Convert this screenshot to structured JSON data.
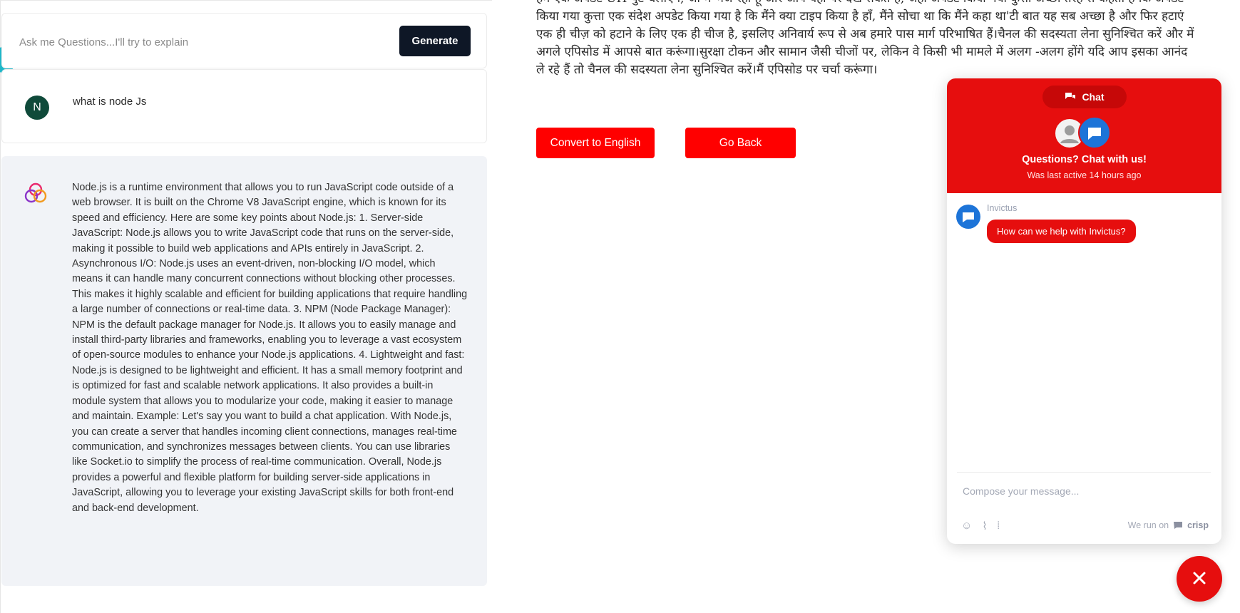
{
  "ask": {
    "placeholder": "Ask me Questions...I'll try to explain",
    "generate_label": "Generate"
  },
  "question": {
    "avatar_initial": "N",
    "text": "what is node Js"
  },
  "answer": {
    "text": "Node.js is a runtime environment that allows you to run JavaScript code outside of a web browser. It is built on the Chrome V8 JavaScript engine, which is known for its speed and efficiency. Here are some key points about Node.js: 1. Server-side JavaScript: Node.js allows you to write JavaScript code that runs on the server-side, making it possible to build web applications and APIs entirely in JavaScript. 2. Asynchronous I/O: Node.js uses an event-driven, non-blocking I/O model, which means it can handle many concurrent connections without blocking other processes. This makes it highly scalable and efficient for building applications that require handling a large number of connections or real-time data. 3. NPM (Node Package Manager): NPM is the default package manager for Node.js. It allows you to easily manage and install third-party libraries and frameworks, enabling you to leverage a vast ecosystem of open-source modules to enhance your Node.js applications. 4. Lightweight and fast: Node.js is designed to be lightweight and efficient. It has a small memory footprint and is optimized for fast and scalable network applications. It also provides a built-in module system that allows you to modularize your code, making it easier to manage and maintain. Example: Let's say you want to build a chat application. With Node.js, you can create a server that handles incoming client connections, manages real-time communication, and synchronizes messages between clients. You can use libraries like Socket.io to simplify the process of real-time communication. Overall, Node.js provides a powerful and flexible platform for building server-side applications in JavaScript, allowing you to leverage your existing JavaScript skills for both front-end and back-end development."
  },
  "translation": {
    "hindi_text": "हम एक अपडेट UH पुट चलाएंगे, जो मैं भेज रहा हूँ और आप यहाँ पर देख सकते हैं, जहाँ अपडेट किया गया कुत्ता अच्छी तरह से कहता है कि अपडेट किया गया कुत्ता एक संदेश अपडेट किया गया है कि मैंने क्या टाइप किया है हाँ, मैंने सोचा था कि मैंने कहा था'टी बात यह सब अच्छा है और फिर हटाएं एक ही चीज़ को हटाने के लिए एक ही चीज है, इसलिए अनिवार्य रूप से अब हमारे पास मार्ग परिभाषित हैं।चैनल की सदस्यता लेना सुनिश्चित करें और में अगले एपिसोड में आपसे बात करूंगा।सुरक्षा टोकन और सामान जैसी चीजों पर, लेकिन वे किसी भी मामले में अलग -अलग होंगे यदि आप इसका आनंद ले रहे हैं तो चैनल की सदस्यता लेना सुनिश्चित करें।मैं एपिसोड पर चर्चा करूंगा।",
    "convert_label": "Convert to English",
    "goback_label": "Go Back"
  },
  "chat": {
    "tab_label": "Chat",
    "headline": "Questions? Chat with us!",
    "last_active": "Was last active 14 hours ago",
    "agent_name": "Invictus",
    "agent_message": "How can we help with Invictus?",
    "compose_placeholder": "Compose your message...",
    "powered_prefix": "We run on",
    "powered_brand": "crisp"
  },
  "colors": {
    "accent_red": "#e60e0e",
    "button_red": "#ff0000",
    "dark_button": "#0e1726",
    "answer_bg": "#f1f3f7"
  },
  "icons": [
    "chat-bubbles-icon",
    "user-avatar-icon",
    "agent-avatar-icon",
    "emoji-icon",
    "attachment-icon",
    "voice-icon",
    "crisp-logo-icon",
    "close-icon",
    "answer-logo-icon"
  ]
}
